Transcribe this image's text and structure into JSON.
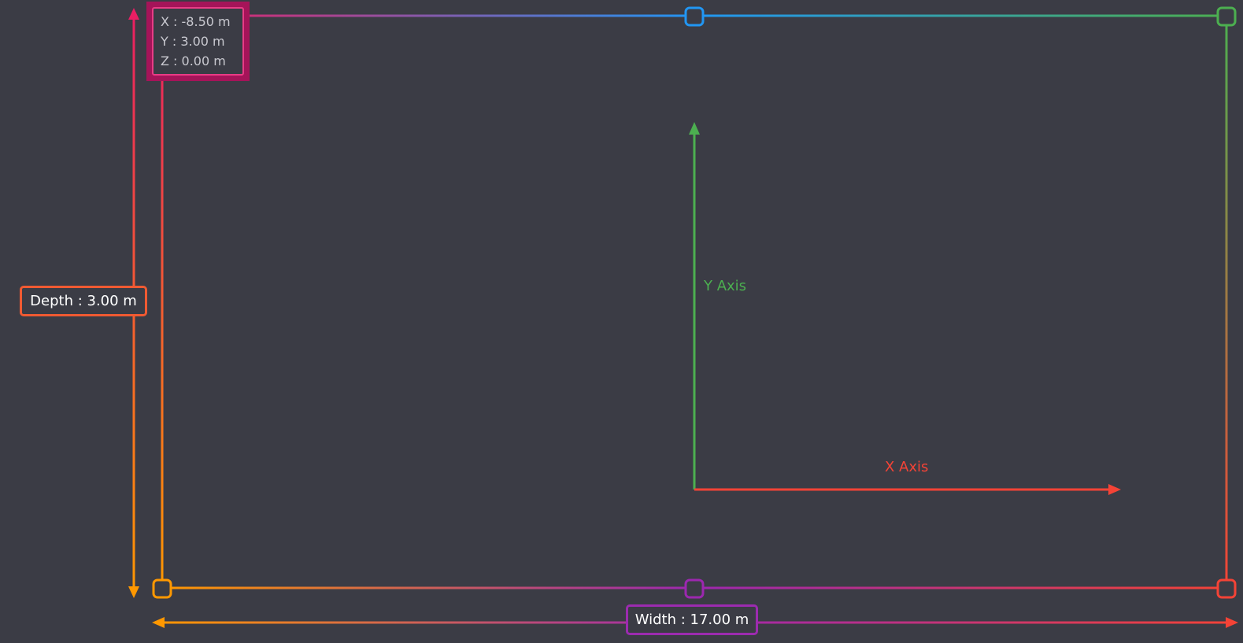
{
  "coordinates": {
    "x": {
      "axis": "X",
      "value": "-8.50 m"
    },
    "y": {
      "axis": "Y",
      "value": "3.00 m"
    },
    "z": {
      "axis": "Z",
      "value": "0.00 m"
    }
  },
  "dimensions": {
    "depth": {
      "label": "Depth",
      "value": "3.00 m"
    },
    "width": {
      "label": "Width",
      "value": "17.00 m"
    }
  },
  "axes": {
    "x_label": "X Axis",
    "y_label": "Y Axis"
  },
  "colors": {
    "background": "#3b3c45",
    "x_axis": "#f44336",
    "y_axis": "#4caf50",
    "top_left_handle": "#e91e63",
    "top_mid_handle": "#2196f3",
    "top_right_handle": "#4caf50",
    "bottom_left_handle": "#ff9800",
    "bottom_mid_handle": "#9c27b0",
    "bottom_right_handle": "#f44336",
    "depth_label_border": "#f05a32",
    "width_label_border": "#9c2bb0",
    "coord_box": "#a51459"
  }
}
